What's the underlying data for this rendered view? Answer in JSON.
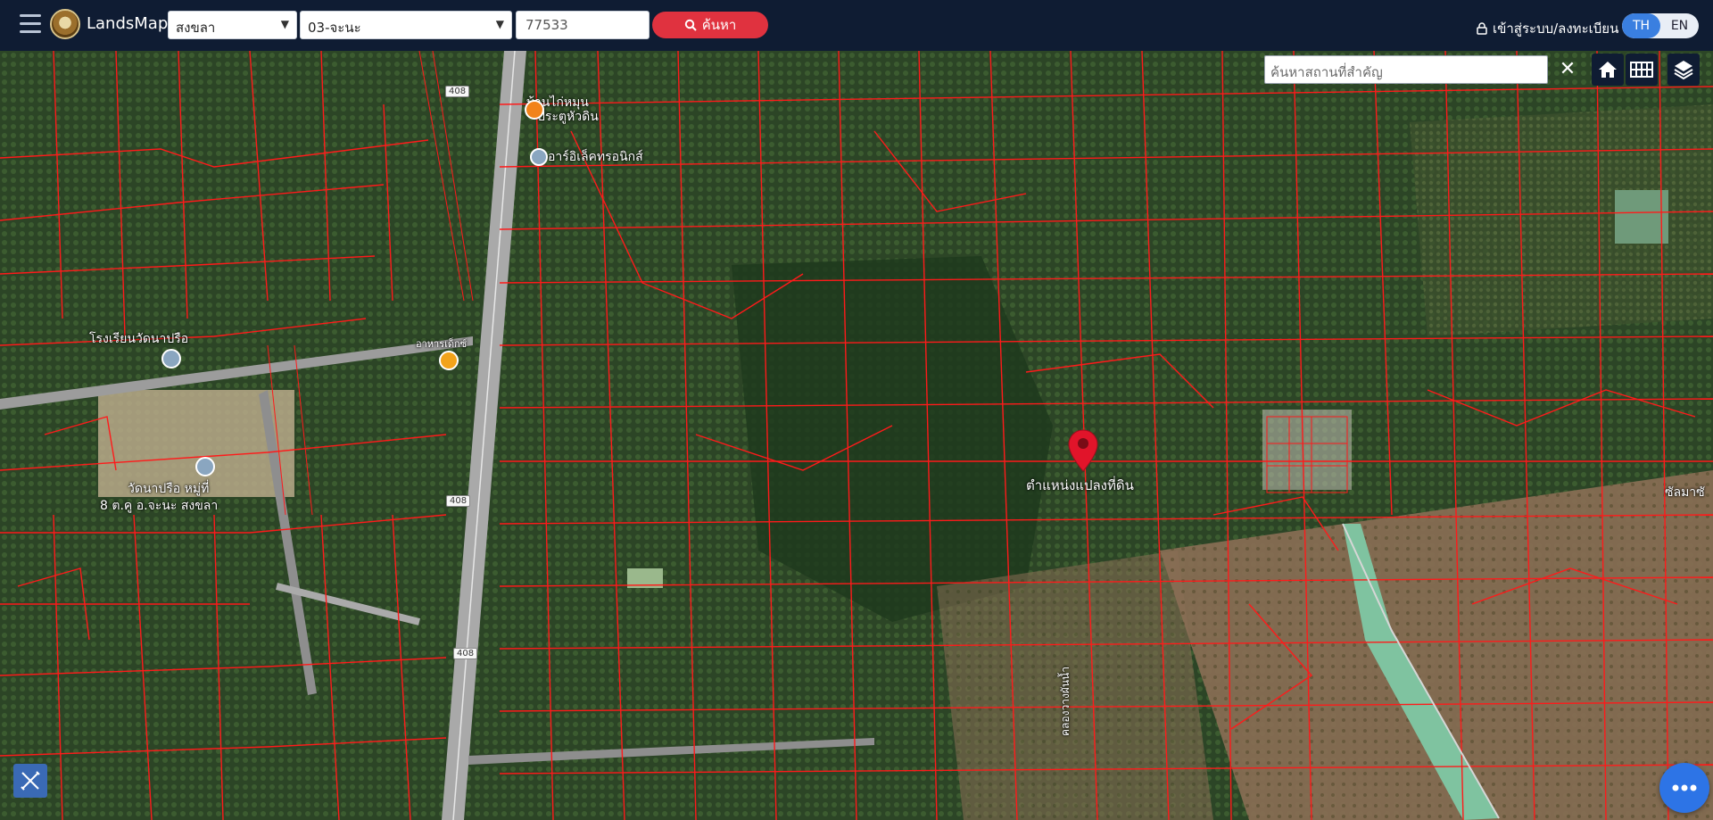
{
  "header": {
    "brand": "LandsMaps",
    "province_select": "สงขลา",
    "district_select": "03-จะนะ",
    "parcel_input_value": "77533",
    "search_button": "ค้นหา",
    "login_link": "เข้าสู่ระบบ/ลงทะเบียน",
    "lang_th": "TH",
    "lang_en": "EN"
  },
  "map": {
    "place_search_placeholder": "ค้นหาสถานที่สำคัญ",
    "clear_symbol": "✕",
    "marker_label": "ตำแหน่งแปลงที่ดิน",
    "labels": {
      "school": "โรงเรียนวัดนาปรือ",
      "temple": "วัดนาปรือ หมู่ที่",
      "temple_addr": "8 ต.คู อ.จะนะ สงขลา",
      "shop1": "บ้านไก่หมุน",
      "shop1b": "ประตูหัวดิน",
      "shop2": "อาร์อิเล็คทรอนิกส์",
      "restaurant": "อาหารเด็กซ์",
      "canal": "คลองวางผันน้ำ",
      "right_edge": "ซัลมาซั"
    },
    "routes": [
      "408",
      "408",
      "408"
    ]
  },
  "colors": {
    "header_bg": "#0f1c33",
    "accent_red": "#e0323f",
    "lang_active": "#3a7fe0",
    "parcel_line": "#ff1a1a"
  },
  "icons": [
    "menu-icon",
    "search-icon",
    "lock-icon",
    "home-icon",
    "grid-icon",
    "layers-icon",
    "map-pin-icon",
    "ruler-icon",
    "chat-icon"
  ]
}
